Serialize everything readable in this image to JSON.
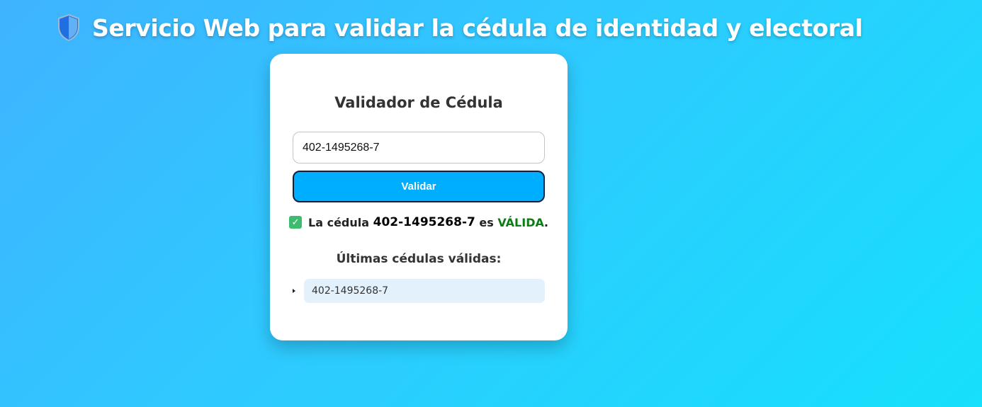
{
  "header": {
    "icon": "shield-icon",
    "title": "Servicio Web para validar la cédula de identidad y electoral"
  },
  "card": {
    "title": "Validador de Cédula",
    "input_value": "402-1495268-7",
    "button_label": "Validar",
    "result": {
      "icon": "check-icon",
      "prefix": "La cédula ",
      "number": "402-1495268-7",
      "middle": " es ",
      "status": "VÁLIDA",
      "suffix": "."
    },
    "list_title": "Últimas cédulas válidas:",
    "valid_cedulas": [
      "402-1495268-7"
    ]
  },
  "colors": {
    "background_start": "#3fb3ff",
    "background_end": "#16e0fb",
    "button": "#00aeff",
    "valid_status": "#0b7d14",
    "list_item_bg": "#e3f1fd"
  }
}
